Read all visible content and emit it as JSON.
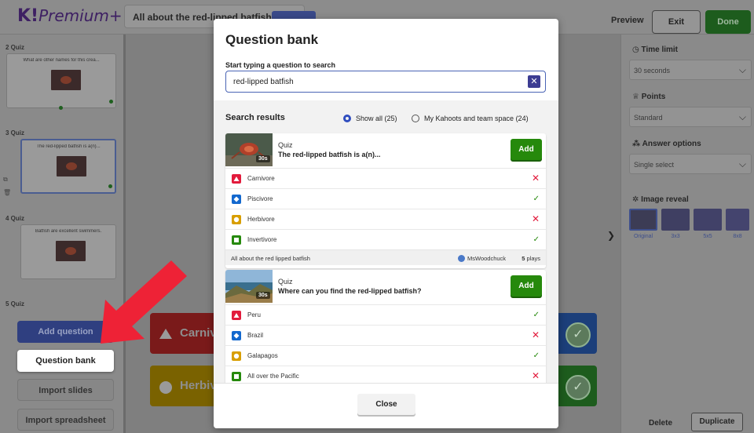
{
  "topbar": {
    "logo_k": "K!",
    "logo_premium": "Premium+",
    "doc_title": "All about the red-lipped batfish",
    "preview": "Preview",
    "exit": "Exit",
    "done": "Done"
  },
  "left_panel": {
    "slides": [
      {
        "label": "2 Quiz",
        "question": "What are other names for this crea..."
      },
      {
        "label": "3 Quiz",
        "question": "The red-lipped batfish is a(n)..."
      },
      {
        "label": "4 Quiz",
        "question": "Batfish are excellent swimmers."
      },
      {
        "label": "5 Quiz",
        "question": ""
      }
    ],
    "add_question": "Add question",
    "question_bank": "Question bank",
    "import_slides": "Import slides",
    "import_spreadsheet": "Import spreadsheet"
  },
  "canvas": {
    "answers": [
      {
        "text": "Carniv",
        "color": "#7a1a1a"
      },
      {
        "text": "Herbiv",
        "color": "#7a6200"
      }
    ]
  },
  "right_panel": {
    "time_limit_label": "Time limit",
    "time_limit_value": "30 seconds",
    "points_label": "Points",
    "points_value": "Standard",
    "answer_options_label": "Answer options",
    "answer_options_value": "Single select",
    "image_reveal_label": "Image reveal",
    "reveal_options": [
      "Original",
      "3x3",
      "5x5",
      "8x8"
    ],
    "delete": "Delete",
    "duplicate": "Duplicate"
  },
  "modal": {
    "title": "Question bank",
    "search_label": "Start typing a question to search",
    "search_value": "red-lipped batfish",
    "results_title": "Search results",
    "filter_all": "Show all (25)",
    "filter_mine": "My Kahoots and team space (24)",
    "close": "Close",
    "results": [
      {
        "type": "Quiz",
        "time": "30s",
        "question": "The red-lipped batfish is a(n)...",
        "add": "Add",
        "answers": [
          {
            "text": "Carnivore",
            "correct": false,
            "mark": "✕"
          },
          {
            "text": "Piscivore",
            "correct": true,
            "mark": "✓"
          },
          {
            "text": "Herbivore",
            "correct": false,
            "mark": "✕"
          },
          {
            "text": "Invertivore",
            "correct": true,
            "mark": "✓"
          }
        ],
        "kahoot": "All about the red lipped batfish",
        "user": "MsWoodchuck",
        "plays_count": "5",
        "plays_word": "plays"
      },
      {
        "type": "Quiz",
        "time": "30s",
        "question": "Where can you find the red-lipped batfish?",
        "add": "Add",
        "answers": [
          {
            "text": "Peru",
            "correct": true,
            "mark": "✓"
          },
          {
            "text": "Brazil",
            "correct": false,
            "mark": "✕"
          },
          {
            "text": "Galapagos",
            "correct": true,
            "mark": "✓"
          },
          {
            "text": "All over the Pacific",
            "correct": false,
            "mark": "✕"
          }
        ]
      }
    ]
  },
  "colors": {
    "red": "#e21b3c",
    "blue": "#1368ce",
    "yellow": "#d89e00",
    "green": "#26890c",
    "accent": "#2f4dbf"
  }
}
